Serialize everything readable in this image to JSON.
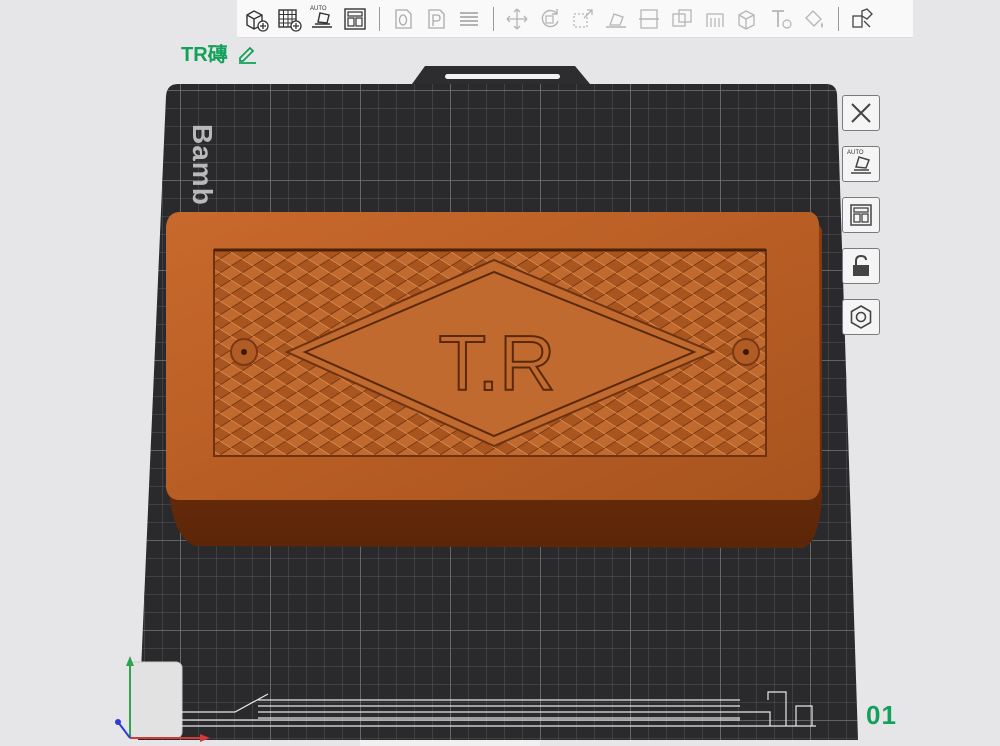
{
  "plate": {
    "name": "TR磚",
    "number": "01",
    "brand_text": "Bamb"
  },
  "model": {
    "emboss_text": "T.R",
    "color": "#b8602a"
  },
  "toolbar": {
    "icons": [
      "add-cube-icon",
      "grid-plate-icon",
      "auto-orient-icon",
      "arrange-icon",
      "plate-o-icon",
      "plate-p-icon",
      "layers-icon",
      "move-icon",
      "rotate-icon",
      "scale-icon",
      "lay-on-face-icon",
      "cut-icon",
      "boolean-icon",
      "support-paint-icon",
      "seam-icon",
      "text-icon",
      "color-paint-icon",
      "assembly-view-icon"
    ]
  },
  "side_tools": [
    "close-icon",
    "auto-orient-icon",
    "arrange-icon",
    "lock-icon",
    "settings-nut-icon"
  ],
  "colors": {
    "accent": "#13a05a",
    "plate": "#2b2b2d",
    "grid": "#5a5a5c"
  }
}
